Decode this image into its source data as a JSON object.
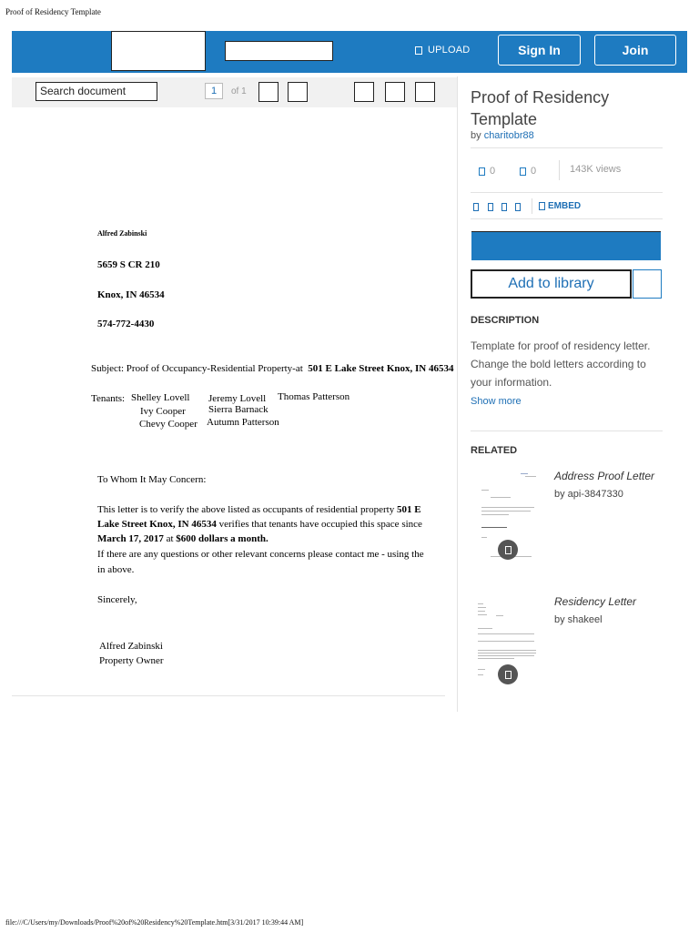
{
  "print": {
    "title": "Proof of Residency Template",
    "footer": "file:///C/Users/my/Downloads/Proof%20of%20Residency%20Template.htm[3/31/2017 10:39:44 AM]"
  },
  "header": {
    "upload_label": "UPLOAD",
    "signin_label": "Sign In",
    "join_label": "Join",
    "brand_color": "#1e7bc1"
  },
  "toolbar": {
    "search_placeholder": "Search document",
    "page_current": "1",
    "page_of": "of 1"
  },
  "document": {
    "sender_name": "Alfred Zabinski",
    "address_line1": "5659 S CR 210",
    "address_line2": "Knox, IN 46534",
    "phone": "574-772-4430",
    "subject_prefix": "Subject: Proof of Occupancy-Residential Property-at",
    "subject_address": "501 E Lake Street Knox, IN 46534",
    "tenants_label": "Tenants:",
    "tenants": [
      "Shelley  Lovell",
      "Jeremy Lovell",
      "Thomas Patterson",
      "Ivy Cooper",
      "Sierra Barnack",
      "Chevy Cooper",
      "Autumn Patterson"
    ],
    "salutation": "To Whom It May Concern:",
    "body_1a": "This letter is to verify the above listed as occupants of residential property ",
    "body_1b": "501 E",
    "body_2a": "Lake Street Knox, IN 46534",
    "body_2b": " verifies that tenants have occupied this space since",
    "body_3a": "March  17,  2017",
    "body_3b": "  at ",
    "body_3c": "$600 dollars a month.",
    "body_4": "If there are any questions or other relevant concerns please contact me - using the",
    "body_5": "in above.",
    "closing": "Sincerely,",
    "signature_name": "Alfred Zabinski",
    "signature_title": "Property Owner"
  },
  "sidebar": {
    "title": "Proof of Residency Template",
    "by_label": "by ",
    "author": "charitobr88",
    "upvotes": "0",
    "downvotes": "0",
    "views": "143K views",
    "embed_label": "EMBED",
    "add_library_label": "Add to library",
    "description_heading": "DESCRIPTION",
    "description": "Template for proof of residency letter. Change the bold letters according to your information.",
    "show_more": "Show more",
    "related_heading": "RELATED",
    "related": [
      {
        "title": "Address Proof Letter",
        "by": "by api-3847330"
      },
      {
        "title": "Residency Letter",
        "by": "by shakeel"
      }
    ]
  }
}
